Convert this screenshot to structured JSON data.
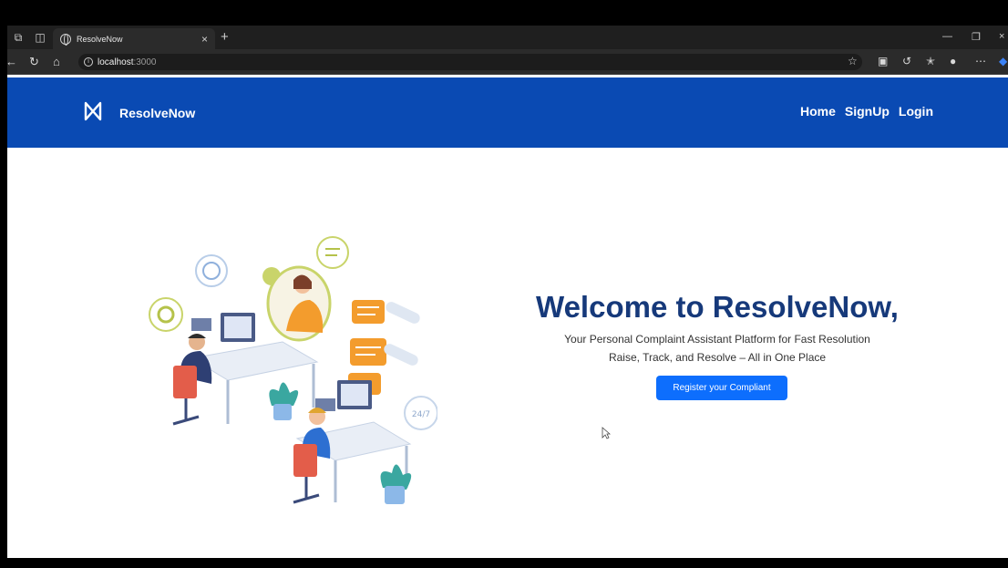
{
  "browser": {
    "tab_title": "ResolveNow",
    "url_host": "localhost",
    "url_port": ":3000",
    "new_tab_label": "+"
  },
  "navbar": {
    "brand": "ResolveNow",
    "links": [
      "Home",
      "SignUp",
      "Login"
    ],
    "background": "#0a4ab3"
  },
  "hero": {
    "headline": "Welcome to ResolveNow,",
    "subtitle": "Your Personal Complaint Assistant Platform for Fast Resolution",
    "tagline": "Raise, Track, and Resolve – All in One Place",
    "cta_label": "Register your Compliant",
    "headline_color": "#16397a",
    "cta_color": "#0d6efd"
  },
  "icons": {
    "logo": "resolvenow-logo-icon",
    "illustration": "support-agents-illustration"
  }
}
